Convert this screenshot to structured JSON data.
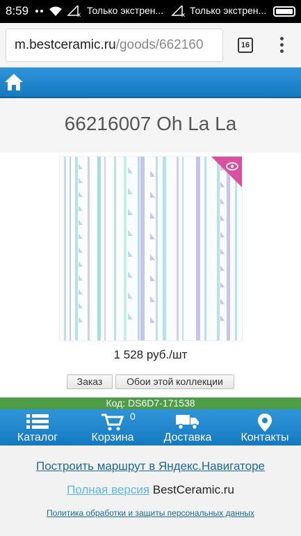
{
  "status_bar": {
    "time": "8:59",
    "carrier_1": "Только экстрен...",
    "carrier_2": "Только экстрен..."
  },
  "browser": {
    "url_host": "m.bestceramic.ru",
    "url_path": "/goods/662160",
    "tabs_count": "16"
  },
  "product": {
    "title": "66216007 Oh La La",
    "price": "1 528 руб./шт",
    "order_button": "Заказ",
    "collection_button": "Обои этой коллекции",
    "code": "Код: DS6D7-171538"
  },
  "bottom_nav": {
    "catalog": "Каталог",
    "cart": "Корзина",
    "cart_count": "0",
    "delivery": "Доставка",
    "contacts": "Контакты"
  },
  "footer": {
    "route_link": "Построить маршрут в Яндекс.Навигаторе",
    "full_version_link": "Полная версия",
    "site_name": "BestCeramic.ru",
    "policy_link": "Политика обработки и защиты персональных данных"
  },
  "colors": {
    "header_blue": "#1f86cc",
    "code_green": "#4e9b48",
    "ribbon_pink": "#d9509e"
  }
}
